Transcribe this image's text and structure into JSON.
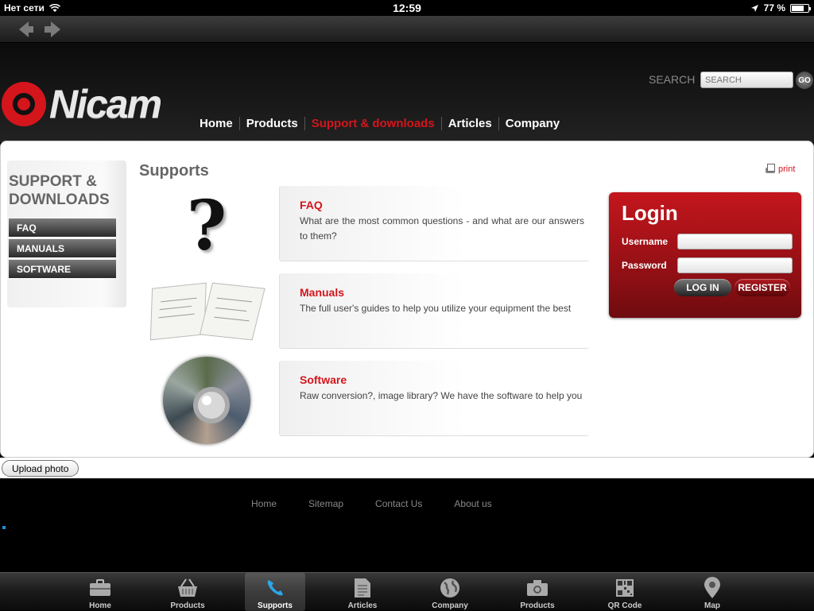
{
  "status_bar": {
    "carrier": "Нет сети",
    "time": "12:59",
    "battery": "77 %",
    "battery_level": 0.77
  },
  "header": {
    "logo_text": "Nicam",
    "search_label": "SEARCH",
    "search_placeholder": "SEARCH",
    "go_label": "GO",
    "nav": [
      {
        "label": "Home"
      },
      {
        "label": "Products"
      },
      {
        "label": "Support & downloads",
        "active": true
      },
      {
        "label": "Articles"
      },
      {
        "label": "Company"
      }
    ]
  },
  "sidebar": {
    "title_line1": "SUPPORT &",
    "title_line2": "DOWNLOADS",
    "items": [
      {
        "label": "FAQ"
      },
      {
        "label": "MANUALS"
      },
      {
        "label": "SOFTWARE"
      }
    ]
  },
  "main": {
    "title": "Supports",
    "print_label": "print",
    "rows": [
      {
        "title": "FAQ",
        "text": "What are the most common questions - and what are our answers to them?",
        "icon": "question-mark-icon"
      },
      {
        "title": "Manuals",
        "text": "The full user's guides to help you utilize your equipment the best",
        "icon": "book-icon"
      },
      {
        "title": "Software",
        "text": "Raw conversion?, image library? We have the software to help you",
        "icon": "disc-icon"
      }
    ]
  },
  "login": {
    "title": "Login",
    "username_label": "Username",
    "password_label": "Password",
    "login_button": "LOG IN",
    "register_button": "REGISTER"
  },
  "upload_button": "Upload photo",
  "footer": {
    "links": [
      "Home",
      "Sitemap",
      "Contact Us",
      "About us"
    ]
  },
  "tabbar": [
    {
      "label": "Home",
      "icon": "briefcase-icon"
    },
    {
      "label": "Products",
      "icon": "basket-icon"
    },
    {
      "label": "Supports",
      "icon": "phone-icon",
      "selected": true
    },
    {
      "label": "Articles",
      "icon": "document-icon"
    },
    {
      "label": "Company",
      "icon": "globe-icon"
    },
    {
      "label": "Products",
      "icon": "camera-icon"
    },
    {
      "label": "QR Code",
      "icon": "qr-code-icon"
    },
    {
      "label": "Map",
      "icon": "map-pin-icon"
    }
  ],
  "colors": {
    "brand_red": "#d4151c",
    "background": "#000000"
  }
}
